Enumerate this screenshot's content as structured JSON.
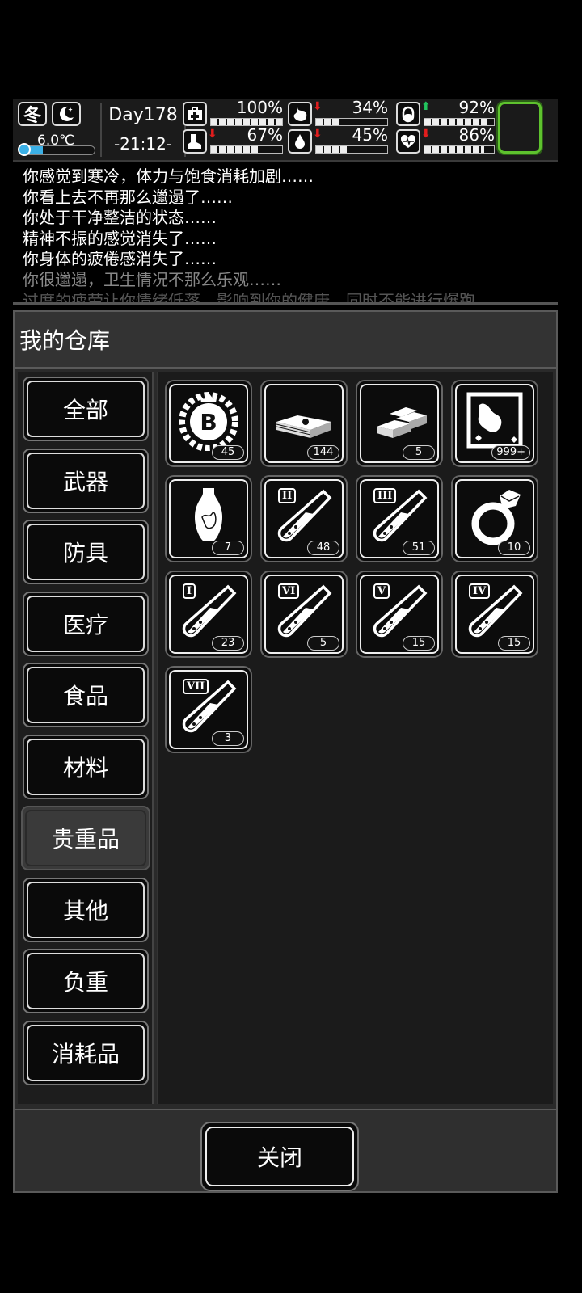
{
  "status": {
    "season": "冬",
    "night_icon": "moon-star-icon",
    "temperature": "6.0℃",
    "temperature_level": 0.3,
    "day": "Day178",
    "time": "-21:12-",
    "stats": [
      {
        "icon": "medkit-icon",
        "trend": "",
        "value": "100%",
        "level": 1.0
      },
      {
        "icon": "stomach-icon",
        "trend": "down",
        "value": "34%",
        "level": 0.34
      },
      {
        "icon": "pill-icon",
        "trend": "up",
        "value": "92%",
        "level": 0.92
      },
      {
        "icon": "boot-icon",
        "trend": "down",
        "value": "67%",
        "level": 0.67
      },
      {
        "icon": "water-drop-icon",
        "trend": "down",
        "value": "45%",
        "level": 0.45
      },
      {
        "icon": "heart-icon",
        "trend": "down",
        "value": "86%",
        "level": 0.86
      }
    ],
    "colors": {
      "up": "#22c55e",
      "down": "#e11d1d",
      "temp": "#3bb0e6",
      "frame": "#5ec22e"
    }
  },
  "log": [
    "你感觉到寒冷，体力与饱食消耗加剧……",
    "你看上去不再那么邋遢了……",
    "你处于干净整洁的状态……",
    "精神不振的感觉消失了……",
    "你身体的疲倦感消失了……",
    "你很邋遢，卫生情况不那么乐观……",
    "过度的疲劳让你情绪低落，影响到你的健康，同时不能进行爆跑"
  ],
  "panel": {
    "title": "我的仓库",
    "close_label": "关闭",
    "categories": [
      "全部",
      "武器",
      "防具",
      "医疗",
      "食品",
      "材料",
      "贵重品",
      "其他",
      "负重",
      "消耗品"
    ],
    "selected_category": "贵重品",
    "items": [
      {
        "icon": "bitcoin-chip-icon",
        "count": "45"
      },
      {
        "icon": "cash-stack-icon",
        "count": "144"
      },
      {
        "icon": "gold-bars-icon",
        "count": "5"
      },
      {
        "icon": "painting-icon",
        "count": "999+"
      },
      {
        "icon": "vase-icon",
        "count": "7"
      },
      {
        "icon": "test-tube-icon",
        "tag": "II",
        "count": "48"
      },
      {
        "icon": "test-tube-icon",
        "tag": "III",
        "count": "51"
      },
      {
        "icon": "diamond-ring-icon",
        "count": "10"
      },
      {
        "icon": "test-tube-icon",
        "tag": "I",
        "count": "23"
      },
      {
        "icon": "test-tube-icon",
        "tag": "VI",
        "count": "5"
      },
      {
        "icon": "test-tube-icon",
        "tag": "V",
        "count": "15"
      },
      {
        "icon": "test-tube-icon",
        "tag": "IV",
        "count": "15"
      },
      {
        "icon": "test-tube-icon",
        "tag": "VII",
        "count": "3"
      }
    ]
  }
}
